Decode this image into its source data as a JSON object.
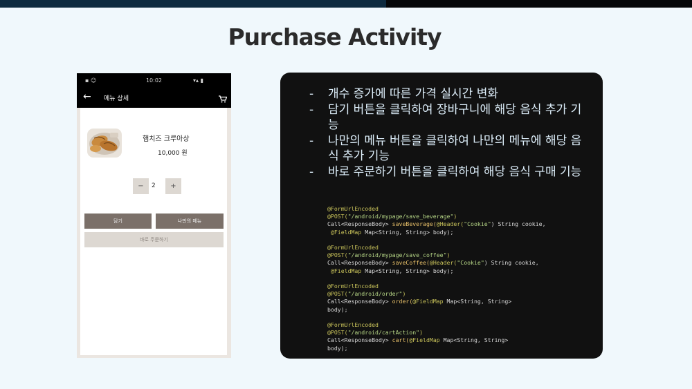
{
  "slide": {
    "title": "Purchase Activity"
  },
  "phone": {
    "status": {
      "left": "▪ ☺",
      "time": "10:02",
      "right": "▾▴ ▮"
    },
    "appbar": {
      "back": "←",
      "title": "메뉴 상세",
      "cart_icon": "cart-icon"
    },
    "product": {
      "name": "햄치즈 크루아상",
      "price": "10,000 원"
    },
    "quantity": {
      "minus": "−",
      "value": "2",
      "plus": "+"
    },
    "buttons": {
      "cart": "담기",
      "my_menu": "나만의 메뉴",
      "order_now": "바로 주문하기"
    }
  },
  "bullets": [
    {
      "dash": "-",
      "text": "개수 증가에 따른 가격 실시간 변화"
    },
    {
      "dash": "-",
      "text": "담기 버튼을 클릭하여 장바구니에 해당 음식 추가 기능"
    },
    {
      "dash": "-",
      "text": "나만의 메뉴 버튼을 클릭하여 나만의 메뉴에 해당 음식 추가 기능"
    },
    {
      "dash": "-",
      "text": "바로 주문하기 버튼을 클릭하여 해당 음식 구매 기능"
    }
  ],
  "code": [
    [
      {
        "t": "@FormUrlEncoded",
        "c": "ann"
      }
    ],
    [
      {
        "t": "@POST(",
        "c": "ann"
      },
      {
        "t": "\"/android/mypage/save_beverage\"",
        "c": "str"
      },
      {
        "t": ")",
        "c": "ann"
      }
    ],
    [
      {
        "t": "Call<ResponseBody> ",
        "c": ""
      },
      {
        "t": "saveBeverage(",
        "c": "fn"
      },
      {
        "t": "@Header(",
        "c": "ann"
      },
      {
        "t": "\"Cookie\"",
        "c": "str"
      },
      {
        "t": ") String cookie,",
        "c": ""
      }
    ],
    [
      {
        "t": " @FieldMap ",
        "c": "ann"
      },
      {
        "t": "Map<String, String> body);",
        "c": ""
      }
    ],
    [
      {
        "t": "",
        "c": ""
      }
    ],
    [
      {
        "t": "@FormUrlEncoded",
        "c": "ann"
      }
    ],
    [
      {
        "t": "@POST(",
        "c": "ann"
      },
      {
        "t": "\"/android/mypage/save_coffee\"",
        "c": "str"
      },
      {
        "t": ")",
        "c": "ann"
      }
    ],
    [
      {
        "t": "Call<ResponseBody> ",
        "c": ""
      },
      {
        "t": "saveCoffee(",
        "c": "fn"
      },
      {
        "t": "@Header(",
        "c": "ann"
      },
      {
        "t": "\"Cookie\"",
        "c": "str"
      },
      {
        "t": ") String cookie,",
        "c": ""
      }
    ],
    [
      {
        "t": " @FieldMap ",
        "c": "ann"
      },
      {
        "t": "Map<String, String> body);",
        "c": ""
      }
    ],
    [
      {
        "t": "",
        "c": ""
      }
    ],
    [
      {
        "t": "@FormUrlEncoded",
        "c": "ann"
      }
    ],
    [
      {
        "t": "@POST(",
        "c": "ann"
      },
      {
        "t": "\"/android/order\"",
        "c": "str"
      },
      {
        "t": ")",
        "c": "ann"
      }
    ],
    [
      {
        "t": "Call<ResponseBody> ",
        "c": ""
      },
      {
        "t": "order(",
        "c": "fn"
      },
      {
        "t": "@FieldMap ",
        "c": "ann"
      },
      {
        "t": "Map<String, String>",
        "c": ""
      }
    ],
    [
      {
        "t": "body);",
        "c": ""
      }
    ],
    [
      {
        "t": "",
        "c": ""
      }
    ],
    [
      {
        "t": "@FormUrlEncoded",
        "c": "ann"
      }
    ],
    [
      {
        "t": "@POST(",
        "c": "ann"
      },
      {
        "t": "\"/android/cartAction\"",
        "c": "str"
      },
      {
        "t": ")",
        "c": "ann"
      }
    ],
    [
      {
        "t": "Call<ResponseBody> ",
        "c": ""
      },
      {
        "t": "cart(",
        "c": "fn"
      },
      {
        "t": "@FieldMap ",
        "c": "ann"
      },
      {
        "t": "Map<String, String>",
        "c": ""
      }
    ],
    [
      {
        "t": "body);",
        "c": ""
      }
    ]
  ],
  "colors": {
    "panel_bg": "#111111",
    "bullet_text": "#ddeefa",
    "button_dark": "#7b7069",
    "button_light": "#ddd8d2",
    "annotation": "#c9c35a",
    "string": "#b6d686"
  }
}
